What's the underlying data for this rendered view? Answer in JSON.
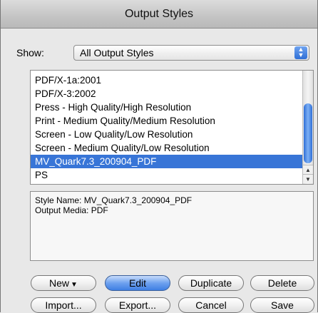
{
  "window": {
    "title": "Output Styles"
  },
  "show": {
    "label": "Show:",
    "selected": "All Output Styles"
  },
  "styles_list": {
    "items": [
      "PDF/X-1a:2001",
      "PDF/X-3:2002",
      "Press - High Quality/High Resolution",
      "Print - Medium Quality/Medium Resolution",
      "Screen - Low Quality/Low Resolution",
      "Screen - Medium Quality/Low Resolution",
      "MV_Quark7.3_200904_PDF",
      "PS"
    ],
    "selected_index": 6
  },
  "info": {
    "style_name": "Style Name: MV_Quark7.3_200904_PDF",
    "output_media": "Output Media: PDF"
  },
  "buttons": {
    "new": "New",
    "edit": "Edit",
    "duplicate": "Duplicate",
    "delete": "Delete",
    "import": "Import...",
    "export": "Export...",
    "cancel": "Cancel",
    "save": "Save"
  },
  "colors": {
    "selection": "#3875d7",
    "accent": "#3f7fe3"
  }
}
